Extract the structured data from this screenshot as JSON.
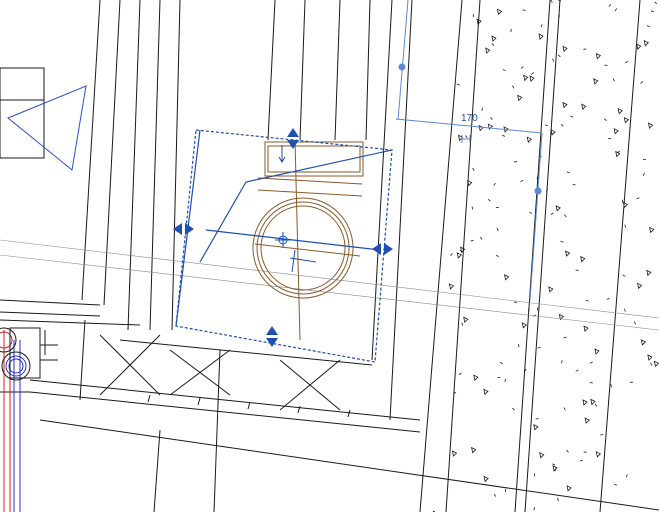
{
  "view": {
    "dimension_label": "170",
    "colors": {
      "background": "#ffffff",
      "linework": "#1a1a1a",
      "light_linework": "#8a8a8a",
      "selection_blue": "#1f4fb0",
      "dimension_blue": "#5a8ad8",
      "element_brown": "#8a5a2a",
      "pipe_red": "#d42020",
      "pipe_blue": "#2030d0"
    },
    "icons": {
      "flip_arrows": "double-arrow-flip-icon",
      "move_control": "move-cross-icon",
      "grip": "circular-grip-icon",
      "hatch": "concrete-hatch-pattern"
    }
  }
}
